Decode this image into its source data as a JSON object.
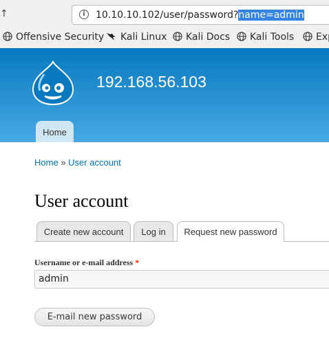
{
  "browser": {
    "url_main": "10.10.10.102/user/password?",
    "url_selected": "name=admin",
    "bookmarks": [
      {
        "label": "Offensive Security",
        "icon": "globe-icon"
      },
      {
        "label": "Kali Linux",
        "icon": "kali-dragon-icon"
      },
      {
        "label": "Kali Docs",
        "icon": "globe-icon"
      },
      {
        "label": "Kali Tools",
        "icon": "globe-icon"
      },
      {
        "label": "Exp",
        "icon": "globe-icon"
      }
    ]
  },
  "site": {
    "name": "192.168.56.103",
    "primary_tab": "Home",
    "header_color_top": "#0779bf",
    "header_color_bottom": "#48a9e4"
  },
  "breadcrumb": {
    "home": "Home",
    "separator": "»",
    "current": "User account"
  },
  "page": {
    "title": "User account",
    "tabs": [
      {
        "label": "Create new account",
        "active": false
      },
      {
        "label": "Log in",
        "active": false
      },
      {
        "label": "Request new password",
        "active": true
      }
    ]
  },
  "form": {
    "label": "Username or e-mail address",
    "required_marker": "*",
    "value": "admin",
    "submit_label": "E-mail new password"
  }
}
